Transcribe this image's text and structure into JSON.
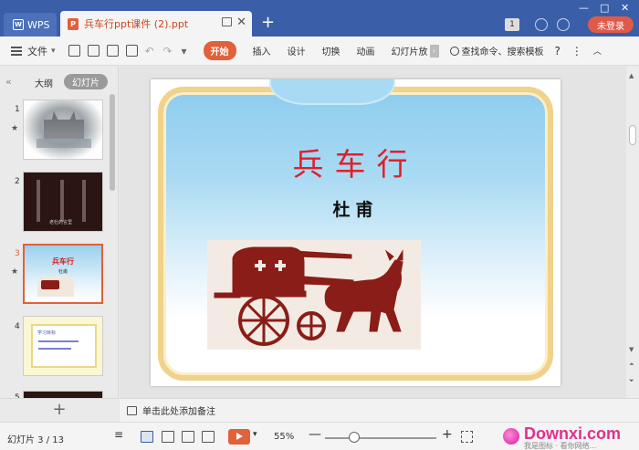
{
  "titlebar": {
    "wps_tab": "WPS",
    "wps_logo": "W",
    "doc_tab": "兵车行ppt课件 (2).ppt",
    "doc_icon": "P",
    "close": "✕",
    "add": "+",
    "window_controls": [
      "—",
      "□",
      "✕"
    ],
    "badge": "1",
    "login": "未登录"
  },
  "toolbar": {
    "file_menu": "文件",
    "start_tab": "开始",
    "tabs": [
      "插入",
      "设计",
      "切换",
      "动画",
      "幻灯片放"
    ],
    "more_arrow": "›",
    "search_cmd": "查找命令、搜索模板",
    "help": "?",
    "more": "⋮",
    "collapse": "︿"
  },
  "left_panel": {
    "collapse": "«",
    "tab_outline": "大纲",
    "tab_slides": "幻灯片",
    "slides": [
      {
        "num": "1",
        "star": "★"
      },
      {
        "num": "2",
        "text": "老杜的言里"
      },
      {
        "num": "3",
        "star": "★",
        "title": "兵车行",
        "author": "杜甫"
      },
      {
        "num": "4",
        "text": "学习目标"
      },
      {
        "num": "5"
      }
    ],
    "add": "+"
  },
  "slide": {
    "title": "兵车行",
    "author": "杜甫"
  },
  "notes": {
    "placeholder": "单击此处添加备注"
  },
  "statusbar": {
    "slide_count": "幻灯片 3 / 13",
    "zoom": "55%",
    "zoom_minus": "—",
    "zoom_plus": "+"
  },
  "watermark": {
    "text": "Downxi.com",
    "sub": "我是图标 · 看你网络..."
  },
  "colors": {
    "accent": "#e0613a",
    "titlebar": "#3a5fa8",
    "slide_title": "#e0202a"
  }
}
